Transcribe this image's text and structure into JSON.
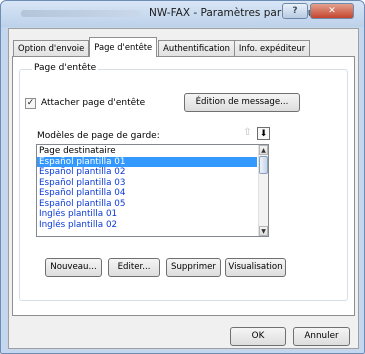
{
  "window": {
    "title": "NW-FAX - Paramètres par défaut"
  },
  "titlebar_buttons": {
    "help": "?",
    "close": "✕"
  },
  "tabs": [
    {
      "label": "Option d'envoie",
      "active": false
    },
    {
      "label": "Page d'entête",
      "active": true
    },
    {
      "label": "Authentification",
      "active": false
    },
    {
      "label": "Info. expéditeur",
      "active": false
    }
  ],
  "group": {
    "title": "Page d'entête"
  },
  "attach": {
    "checked_glyph": "✓",
    "label": "Attacher page d'entête"
  },
  "edit_message_button": "Édition de message...",
  "templates": {
    "label": "Modèles de page de garde:",
    "move_up": "⇧",
    "move_down": "⬇",
    "items": [
      {
        "text": "Page destinataire",
        "state": "normal"
      },
      {
        "text": "Español plantilla 01",
        "state": "selected"
      },
      {
        "text": "Español plantilla 02",
        "state": "link"
      },
      {
        "text": "Español plantilla 03",
        "state": "link"
      },
      {
        "text": "Español plantilla 04",
        "state": "link"
      },
      {
        "text": "Español plantilla 05",
        "state": "link"
      },
      {
        "text": "Inglés plantilla 01",
        "state": "link"
      },
      {
        "text": "Inglés plantilla 02",
        "state": "link"
      }
    ]
  },
  "action_buttons": {
    "new": "Nouveau...",
    "edit": "Editer...",
    "delete": "Supprimer",
    "preview": "Visualisation"
  },
  "footer": {
    "ok": "OK",
    "cancel": "Annuler"
  }
}
